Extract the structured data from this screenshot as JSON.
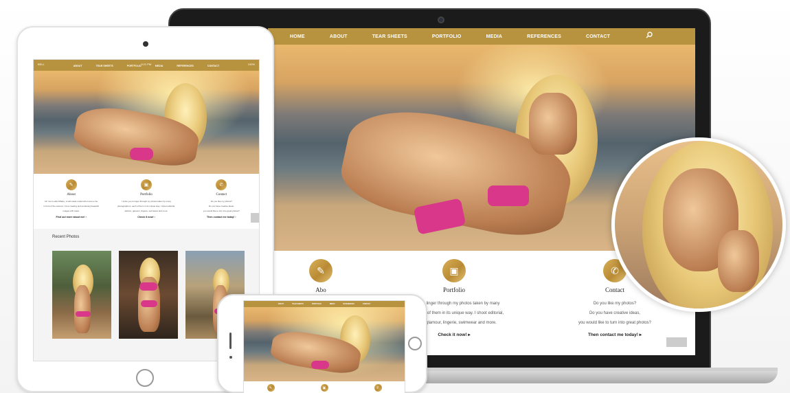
{
  "nav": {
    "items": [
      "HOME",
      "ABOUT",
      "TEAR SHEETS",
      "PORTFOLIO",
      "MEDIA",
      "REFERENCES",
      "CONTACT"
    ]
  },
  "ipad_nav": {
    "items": [
      "ABOUT",
      "TEAR SHEETS",
      "PORTFOLIO",
      "MEDIA",
      "REFERENCES",
      "CONTACT"
    ]
  },
  "ipad_status": {
    "carrier": "BELL",
    "time": "9:21 PM",
    "battery": "100%"
  },
  "icons": {
    "search": "search-icon",
    "about": "edit-icon",
    "portfolio": "image-icon",
    "contact": "phone-icon"
  },
  "colors": {
    "nav_gold": "#b8933f",
    "accent_gold": "#c9a04a"
  },
  "features": {
    "about": {
      "title": "About",
      "lines": [
        "Hi! I am Ledia Kiffarte, a self-made model who loves to be",
        "in front of the camera. I love creating and producing beautiful",
        "images with class."
      ],
      "link": "Find out more about me! ›"
    },
    "portfolio": {
      "title": "Portfolio",
      "lines": [
        "I invite you to linger through my photos taken by many",
        "photographers, each of them in its unique way. I shoot editorial,",
        "fashion, glamour, lingerie, swimwear and more."
      ],
      "link": "Check it now! ›"
    },
    "contact": {
      "title": "Contact",
      "lines": [
        "Do you like my photos?",
        "Do you have creative ideas,",
        "you would like to turn into great photos?"
      ],
      "link": "Then contact me today! ›"
    }
  },
  "laptop_features": {
    "about_title_partial": "Abo",
    "portfolio_lines": [
      "ite you to linger through my photos taken by many",
      "phers, each of them in its unique way. I shoot editorial,",
      "ashion, glamour, lingerie, swimwear and more."
    ],
    "portfolio_link": "Check it now! ▸",
    "contact_link": "Then contact me today! ▸"
  },
  "recent": {
    "title": "Recent Photos"
  }
}
